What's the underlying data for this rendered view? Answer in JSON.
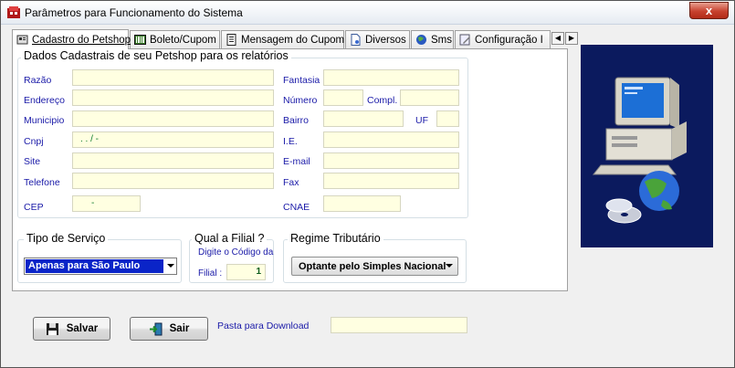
{
  "window": {
    "title": "Parâmetros para Funcionamento do Sistema",
    "close_label": "x"
  },
  "tabs": [
    {
      "label": "Cadastro do Petshop",
      "icon": "petshop-icon",
      "active": true
    },
    {
      "label": "Boleto/Cupom",
      "icon": "barcode-icon"
    },
    {
      "label": "Mensagem do Cupom",
      "icon": "document-icon"
    },
    {
      "label": "Diversos",
      "icon": "page-icon"
    },
    {
      "label": "Sms",
      "icon": "globe-icon"
    },
    {
      "label": "Configuração I",
      "icon": "edit-icon"
    }
  ],
  "dados": {
    "legend": "Dados Cadastrais de seu Petshop para os relatórios",
    "labels": {
      "razao": "Razão",
      "endereco": "Endereço",
      "municipio": "Municipio",
      "cnpj": "Cnpj",
      "site": "Site",
      "telefone": "Telefone",
      "cep": "CEP",
      "fantasia": "Fantasia",
      "numero": "Número",
      "compl": "Compl.",
      "bairro": "Bairro",
      "uf": "UF",
      "ie": "I.E.",
      "email": "E-mail",
      "fax": "Fax",
      "cnae": "CNAE"
    },
    "values": {
      "razao": "",
      "endereco": "",
      "municipio": "",
      "cnpj": ". .   /  -",
      "site": "",
      "telefone": "",
      "cep": "-",
      "fantasia": "",
      "numero": "",
      "compl": "",
      "bairro": "",
      "uf": "",
      "ie": "",
      "email": "",
      "fax": "",
      "cnae": ""
    }
  },
  "tipo_servico": {
    "legend": "Tipo de Serviço",
    "selected": "Apenas para São Paulo"
  },
  "filial": {
    "legend": "Qual a Filial ?",
    "hint": "Digite o Código da",
    "label": "Filial :",
    "value": "1"
  },
  "regime": {
    "legend": "Regime Tributário",
    "selected": "Optante pelo Simples Nacional"
  },
  "footer": {
    "save_label": "Salvar",
    "exit_label": "Sair",
    "download_label": "Pasta para Download",
    "download_value": ""
  },
  "colors": {
    "input_bg": "#ffffe1",
    "label_blue": "#1a1aa8",
    "selected_blue": "#0a24c8",
    "picture_bg": "#0b1a5e"
  }
}
